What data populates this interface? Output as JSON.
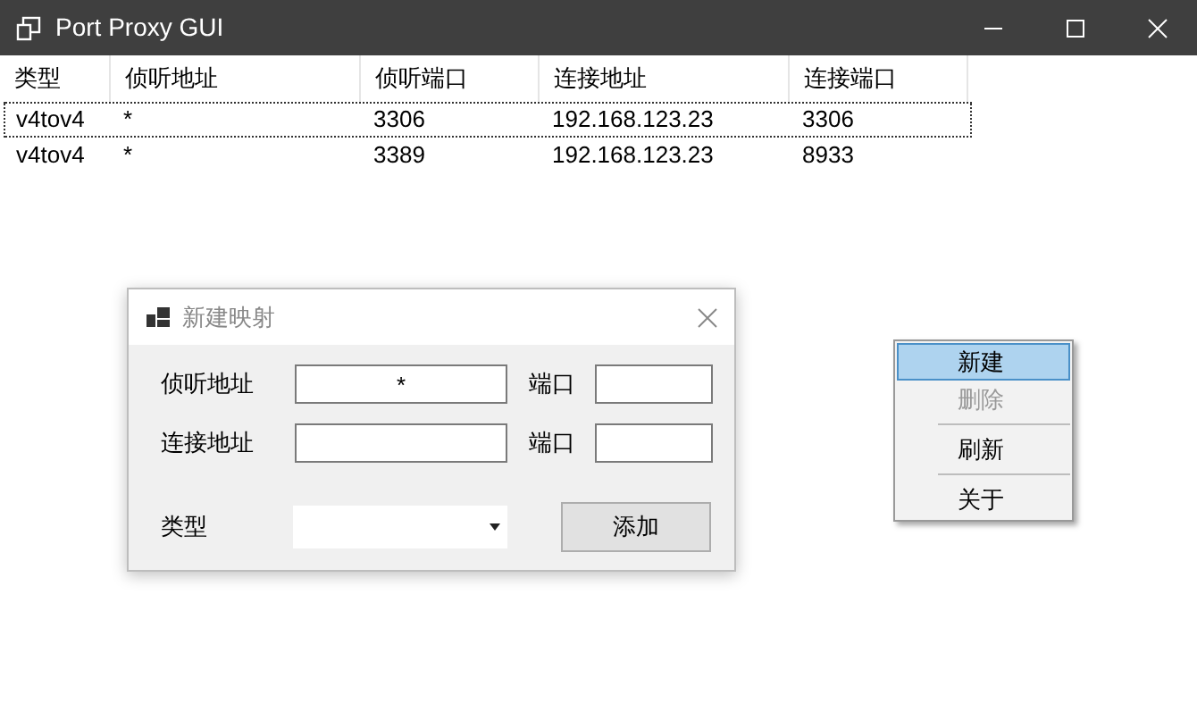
{
  "window": {
    "title": "Port Proxy GUI"
  },
  "table": {
    "columns": [
      "类型",
      "侦听地址",
      "侦听端口",
      "连接地址",
      "连接端口"
    ],
    "rows": [
      {
        "cells": [
          "v4tov4",
          "*",
          "3306",
          "192.168.123.23",
          "3306"
        ],
        "selected": true
      },
      {
        "cells": [
          "v4tov4",
          "*",
          "3389",
          "192.168.123.23",
          "8933"
        ],
        "selected": false
      }
    ]
  },
  "dialog": {
    "title": "新建映射",
    "rows": [
      {
        "label": "侦听地址",
        "value": "*",
        "port_label": "端口"
      },
      {
        "label": "连接地址",
        "port_label": "端口"
      }
    ],
    "type_label": "类型",
    "button": "添加"
  },
  "context_menu": [
    {
      "kind": "item",
      "label": "新建",
      "selected": true,
      "disabled": false
    },
    {
      "kind": "item",
      "label": "删除",
      "selected": false,
      "disabled": true
    },
    {
      "kind": "separator"
    },
    {
      "kind": "item",
      "label": "刷新",
      "selected": false,
      "disabled": false
    },
    {
      "kind": "separator"
    },
    {
      "kind": "item",
      "label": "关于",
      "selected": false,
      "disabled": false
    }
  ]
}
